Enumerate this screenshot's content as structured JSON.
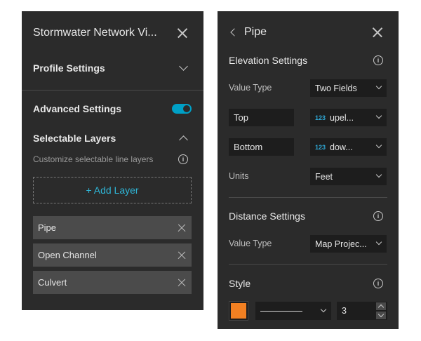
{
  "left_panel": {
    "title": "Stormwater Network Vi...",
    "profile_settings": {
      "label": "Profile Settings"
    },
    "advanced_settings": {
      "label": "Advanced Settings",
      "enabled": true
    },
    "selectable_layers": {
      "label": "Selectable Layers",
      "description": "Customize selectable line layers",
      "add_button": "+ Add Layer",
      "layers": [
        "Pipe",
        "Open Channel",
        "Culvert"
      ]
    }
  },
  "right_panel": {
    "header": {
      "title": "Pipe"
    },
    "elevation": {
      "title": "Elevation Settings",
      "value_type": {
        "label": "Value Type",
        "value": "Two Fields"
      },
      "top": {
        "label": "Top",
        "type_badge": "123",
        "value": "upel..."
      },
      "bottom": {
        "label": "Bottom",
        "type_badge": "123",
        "value": "dow..."
      },
      "units": {
        "label": "Units",
        "value": "Feet"
      }
    },
    "distance": {
      "title": "Distance Settings",
      "value_type": {
        "label": "Value Type",
        "value": "Map Projec..."
      }
    },
    "style": {
      "title": "Style",
      "color": "#f28022",
      "width": "3"
    }
  },
  "colors": {
    "panel_bg": "#2b2b2b",
    "accent": "#00a0c6",
    "field_bg": "#1d1d1d",
    "layer_bg": "#4b4b4b"
  }
}
